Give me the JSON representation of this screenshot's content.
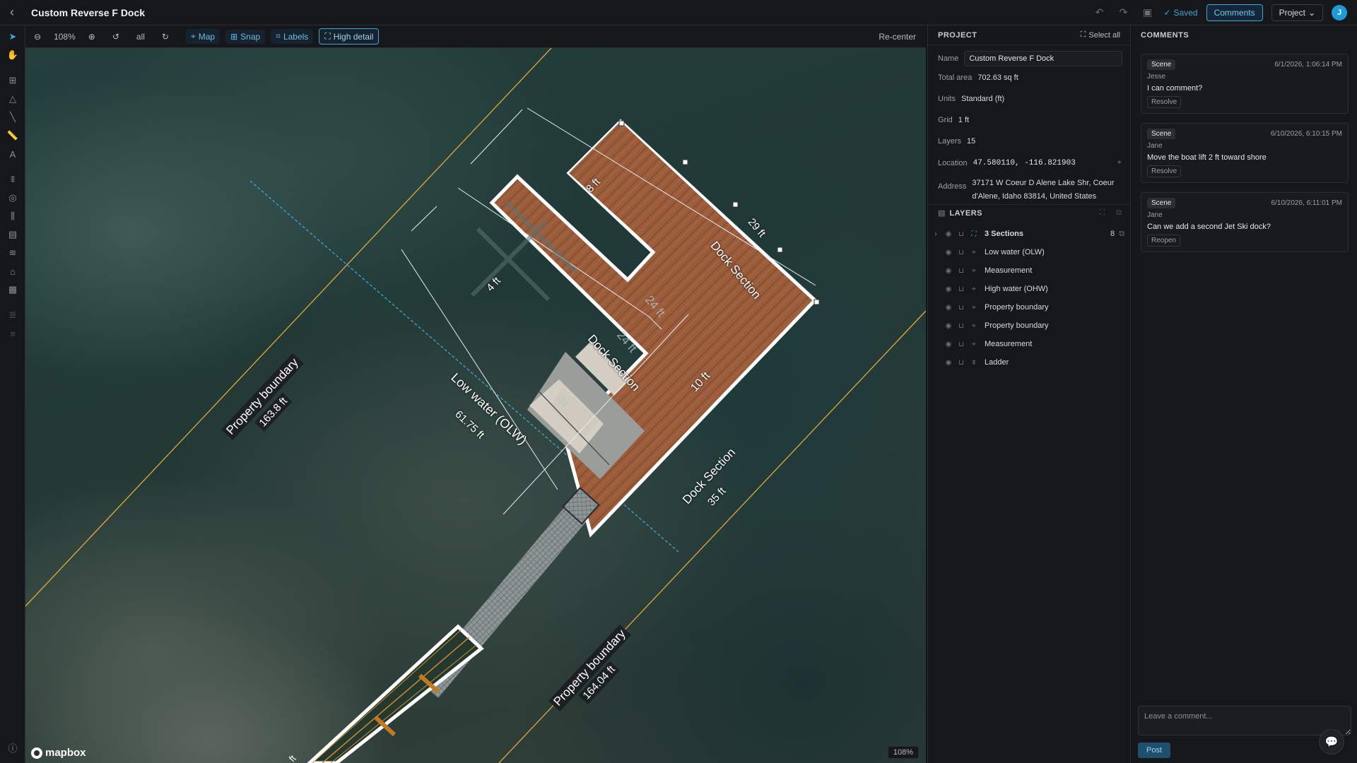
{
  "header": {
    "title": "Custom Reverse F Dock",
    "saved_label": "Saved",
    "comments_label": "Comments",
    "project_label": "Project",
    "avatar_initial": "J"
  },
  "toolbar": {
    "zoom": "108%",
    "scope": "all",
    "map_label": "Map",
    "snap_label": "Snap",
    "labels_label": "Labels",
    "high_detail_label": "High detail",
    "recenter_label": "Re-center"
  },
  "map": {
    "mapbox_label": "mapbox",
    "zoom_badge": "108%",
    "labels": {
      "dock_section": "Dock Section",
      "low_water": "Low water (OLW)",
      "low_water_len": "61.75 ft",
      "prop_boundary": "Property boundary",
      "prop_left_len": "163.8 ft",
      "prop_right_len": "164.04 ft",
      "m_8ft": "8 ft",
      "m_29ft": "29 ft",
      "m_4ft": "4 ft",
      "m_24ft": "24 ft",
      "m_24ft_b": "24 ft",
      "m_24ft_c": "24",
      "m_10ft": "10 ft",
      "m_35ft": "35 ft",
      "m_ft": "ft"
    }
  },
  "project": {
    "heading": "PROJECT",
    "select_all": "Select all",
    "name_label": "Name",
    "name_value": "Custom Reverse F Dock",
    "total_area_label": "Total area",
    "total_area_value": "702.63 sq ft",
    "units_label": "Units",
    "units_value": "Standard (ft)",
    "grid_label": "Grid",
    "grid_value": "1 ft",
    "layers_label": "Layers",
    "layers_value": "15",
    "location_label": "Location",
    "location_value": "47.580110, -116.821903",
    "address_label": "Address",
    "address_line1": "37171 W Coeur D Alene Lake Shr, Coeur",
    "address_line2": "d'Alene, Idaho 83814, United States"
  },
  "layers": {
    "heading": "LAYERS",
    "group": {
      "label": "3 Sections",
      "count": "8"
    },
    "items": [
      {
        "label": "Low water (OLW)",
        "icon": "pin-icon"
      },
      {
        "label": "Measurement",
        "icon": "pin-icon"
      },
      {
        "label": "High water (OHW)",
        "icon": "pin-icon"
      },
      {
        "label": "Property boundary",
        "icon": "pin-icon"
      },
      {
        "label": "Property boundary",
        "icon": "pin-icon"
      },
      {
        "label": "Measurement",
        "icon": "pin-icon"
      },
      {
        "label": "Ladder",
        "icon": "ladder-icon"
      }
    ]
  },
  "comments": {
    "heading": "COMMENTS",
    "items": [
      {
        "tag": "Scene",
        "date": "6/1/2026, 1:06:14 PM",
        "author": "Jesse",
        "text": "I can comment?",
        "action": "Resolve"
      },
      {
        "tag": "Scene",
        "date": "6/10/2026, 6:10:15 PM",
        "author": "Jane",
        "text": "Move the boat lift 2 ft toward shore",
        "action": "Resolve"
      },
      {
        "tag": "Scene",
        "date": "6/10/2026, 6:11:01 PM",
        "author": "Jane",
        "text": "Can we add a second Jet Ski dock?",
        "action": "Reopen"
      }
    ],
    "input_placeholder": "Leave a comment...",
    "post_label": "Post"
  },
  "colors": {
    "accent": "#3fa7d6",
    "boundary": "#e0a93a",
    "wood": "#9a5a3a",
    "water_line": "#3fa7d6"
  }
}
